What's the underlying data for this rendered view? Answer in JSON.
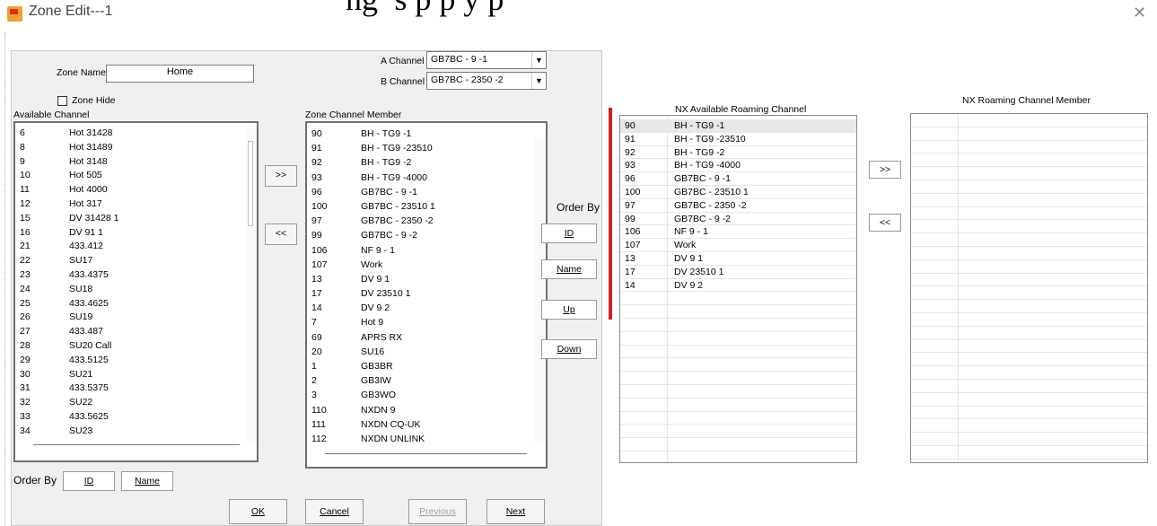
{
  "window": {
    "title": "Zone Edit---1",
    "banner": "ng’      s   p     p   y p"
  },
  "zone": {
    "name_label": "Zone Name",
    "name_value": "Home",
    "hide_label": "Zone Hide",
    "a_channel_label": "A Channel",
    "a_channel_value": "GB7BC - 9 -1",
    "b_channel_label": "B Channel",
    "b_channel_value": "GB7BC - 2350 -2"
  },
  "available": {
    "label": "Available Channel",
    "rows": [
      {
        "id": "6",
        "name": "Hot 31428"
      },
      {
        "id": "8",
        "name": "Hot 31489"
      },
      {
        "id": "9",
        "name": "Hot 3148"
      },
      {
        "id": "10",
        "name": "Hot 505"
      },
      {
        "id": "11",
        "name": "Hot 4000"
      },
      {
        "id": "12",
        "name": "Hot 317"
      },
      {
        "id": "15",
        "name": "DV 31428 1"
      },
      {
        "id": "16",
        "name": "DV 91 1"
      },
      {
        "id": "21",
        "name": "433.412"
      },
      {
        "id": "22",
        "name": "SU17"
      },
      {
        "id": "23",
        "name": "433.4375"
      },
      {
        "id": "24",
        "name": "SU18"
      },
      {
        "id": "25",
        "name": "433.4625"
      },
      {
        "id": "26",
        "name": "SU19"
      },
      {
        "id": "27",
        "name": "433.487"
      },
      {
        "id": "28",
        "name": "SU20 Call"
      },
      {
        "id": "29",
        "name": "433.5125"
      },
      {
        "id": "30",
        "name": "SU21"
      },
      {
        "id": "31",
        "name": "433.5375"
      },
      {
        "id": "32",
        "name": "SU22"
      },
      {
        "id": "33",
        "name": "433.5625"
      },
      {
        "id": "34",
        "name": "SU23"
      }
    ]
  },
  "member": {
    "label": "Zone Channel Member",
    "rows": [
      {
        "id": "90",
        "name": "BH - TG9 -1"
      },
      {
        "id": "91",
        "name": "BH - TG9 -23510"
      },
      {
        "id": "92",
        "name": "BH - TG9 -2"
      },
      {
        "id": "93",
        "name": "BH - TG9 -4000"
      },
      {
        "id": "96",
        "name": "GB7BC - 9 -1"
      },
      {
        "id": "100",
        "name": "GB7BC - 23510 1"
      },
      {
        "id": "97",
        "name": "GB7BC - 2350 -2"
      },
      {
        "id": "99",
        "name": "GB7BC - 9 -2"
      },
      {
        "id": "106",
        "name": "NF 9 - 1"
      },
      {
        "id": "107",
        "name": "Work"
      },
      {
        "id": "13",
        "name": "DV 9 1"
      },
      {
        "id": "17",
        "name": "DV 23510 1"
      },
      {
        "id": "14",
        "name": "DV 9 2"
      },
      {
        "id": "7",
        "name": "Hot  9"
      },
      {
        "id": "69",
        "name": "APRS RX"
      },
      {
        "id": "20",
        "name": "SU16"
      },
      {
        "id": "1",
        "name": "GB3BR"
      },
      {
        "id": "2",
        "name": "GB3IW"
      },
      {
        "id": "3",
        "name": "GB3WO"
      },
      {
        "id": "110",
        "name": "NXDN 9"
      },
      {
        "id": "111",
        "name": "NXDN CQ-UK"
      },
      {
        "id": "112",
        "name": "NXDN UNLINK"
      }
    ]
  },
  "buttons": {
    "add": ">>",
    "remove": "<<",
    "order_by": "Order By",
    "order_id": "ID",
    "order_name": "Name",
    "up": "Up",
    "down": "Down",
    "bottom_order_by": "Order By",
    "bottom_id": "ID",
    "bottom_name": "Name",
    "ok": "OK",
    "cancel": "Cancel",
    "previous": "Previous",
    "next": "Next",
    "nx_add": ">>",
    "nx_remove": "<<"
  },
  "nx_available": {
    "label": "NX Available Roaming Channel",
    "rows": [
      {
        "id": "90",
        "name": "BH - TG9 -1"
      },
      {
        "id": "91",
        "name": "BH - TG9 -23510"
      },
      {
        "id": "92",
        "name": "BH - TG9 -2"
      },
      {
        "id": "93",
        "name": "BH - TG9 -4000"
      },
      {
        "id": "96",
        "name": "GB7BC - 9 -1"
      },
      {
        "id": "100",
        "name": "GB7BC - 23510 1"
      },
      {
        "id": "97",
        "name": "GB7BC - 2350 -2"
      },
      {
        "id": "99",
        "name": "GB7BC - 9 -2"
      },
      {
        "id": "106",
        "name": "NF 9 - 1"
      },
      {
        "id": "107",
        "name": "Work"
      },
      {
        "id": "13",
        "name": "DV 9 1"
      },
      {
        "id": "17",
        "name": "DV 23510 1"
      },
      {
        "id": "14",
        "name": "DV 9 2"
      }
    ]
  },
  "nx_member": {
    "label": "NX Roaming  Channel Member",
    "rows": []
  },
  "colors": {
    "red_marker": "#d62020",
    "dialog_bg": "#f0f0f0"
  }
}
